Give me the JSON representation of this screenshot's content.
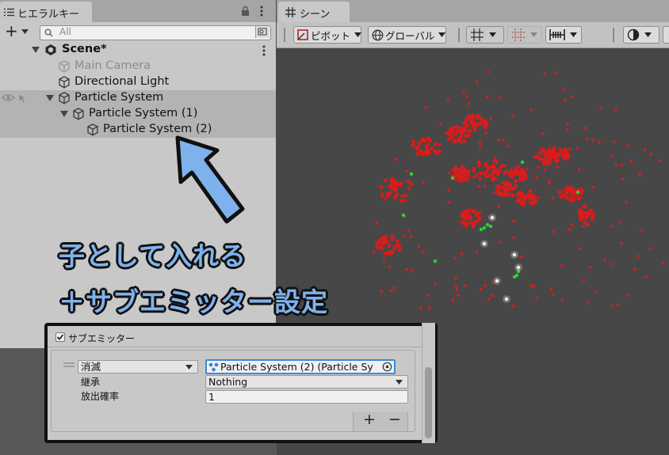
{
  "hierarchy": {
    "tab_label": "ヒエラルキー",
    "add_label": "+",
    "search_placeholder": "All",
    "scene_name": "Scene*",
    "items": [
      {
        "label": "Main Camera",
        "state": "inactive"
      },
      {
        "label": "Directional Light",
        "state": "normal"
      },
      {
        "label": "Particle System",
        "state": "expanded"
      },
      {
        "label": "Particle System (1)",
        "state": "expanded"
      },
      {
        "label": "Particle System (2)",
        "state": "normal"
      }
    ]
  },
  "scene_view": {
    "tab_label": "シーン",
    "pivot_label": "ピボット",
    "global_label": "グローバル",
    "particle_colors": {
      "primary": "#d91c1c",
      "secondary": "#2fcf3a",
      "tertiary": "#ececec"
    }
  },
  "inspector": {
    "module_title": "サブエミッター",
    "module_enabled": true,
    "emitter": {
      "trigger": "消滅",
      "target": "Particle System (2) (Particle Sy",
      "inherit_label": "継承",
      "inherit_value": "Nothing",
      "probability_label": "放出確率",
      "probability_value": "1"
    },
    "add_button": "+",
    "remove_button": "−"
  },
  "annotation": {
    "line1": "子として入れる",
    "line2": "＋サブエミッター設定",
    "text_color": "#7fb2ec"
  }
}
